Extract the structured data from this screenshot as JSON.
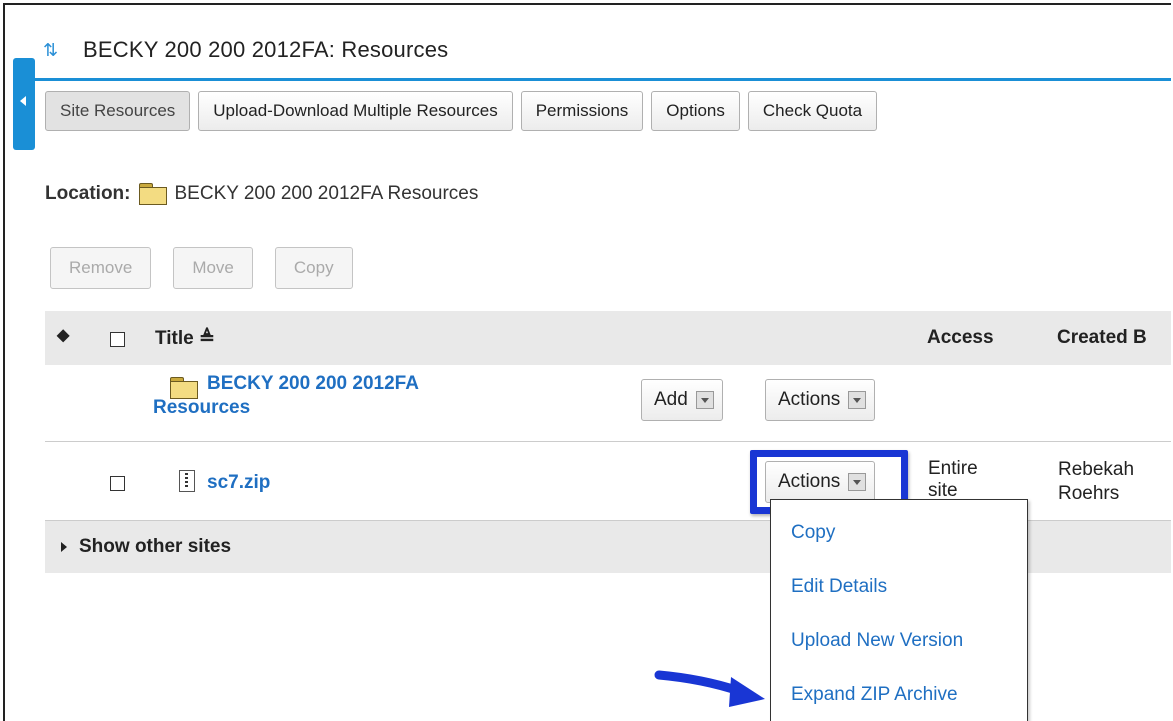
{
  "header": {
    "title": "BECKY 200 200 2012FA: Resources"
  },
  "toolbar": {
    "buttons": [
      "Site Resources",
      "Upload-Download Multiple Resources",
      "Permissions",
      "Options",
      "Check Quota"
    ]
  },
  "location": {
    "label": "Location:",
    "path": "BECKY 200 200 2012FA Resources"
  },
  "bulk_actions": [
    "Remove",
    "Move",
    "Copy"
  ],
  "table": {
    "headers": {
      "title": "Title",
      "access": "Access",
      "created_by": "Created B"
    },
    "root": {
      "title_line1": "BECKY 200 200 2012FA",
      "title_line2": "Resources",
      "add_label": "Add",
      "actions_label": "Actions"
    },
    "file": {
      "name": "sc7.zip",
      "actions_label": "Actions",
      "access_line1": "Entire",
      "access_line2": "site",
      "created_line1": "Rebekah",
      "created_line2": "Roehrs"
    },
    "show_other_sites": "Show other sites"
  },
  "actions_menu": {
    "items": [
      "Copy",
      "Edit Details",
      "Upload New Version",
      "Expand ZIP Archive"
    ]
  },
  "colors": {
    "accent": "#1a8fd6",
    "link": "#1f6fc2",
    "highlight": "#1936d4"
  }
}
